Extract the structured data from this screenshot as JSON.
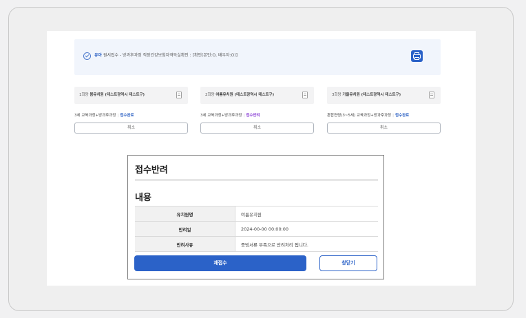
{
  "notice": {
    "highlight": "유아",
    "text": " 원서접수 - 방과후과정 직장건강보험자격득실확인 : [확인(본인:O, 배우자:O)]"
  },
  "choices": [
    {
      "rank": "1희망",
      "name": "봄유치원 (테스트광역시 테스트구)",
      "program": "3세 교육과정+방과후과정",
      "status": "접수완료",
      "cancel": "취소"
    },
    {
      "rank": "2희망",
      "name": "여름유치원 (테스트광역시 테스트구)",
      "program": "3세 교육과정+방과후과정",
      "status": "접수반려",
      "cancel": "취소"
    },
    {
      "rank": "3희망",
      "name": "가을유치원 (테스트광역시 테스트구)",
      "program": "혼합연령(3~5세) 교육과정+방과후과정",
      "status": "접수완료",
      "cancel": "취소"
    }
  ],
  "modal": {
    "title": "접수반려",
    "section": "내용",
    "rows": [
      {
        "label": "유치원명",
        "value": "여름유치원"
      },
      {
        "label": "반려일",
        "value": "2024-00-00 00:00:00"
      },
      {
        "label": "반려사유",
        "value": "증빙서류 부족으로 반려처리 됩니다."
      }
    ],
    "resubmit": "재접수",
    "close": "창닫기"
  },
  "colors": {
    "primary": "#2b62c8",
    "status_done": "#2d62c4",
    "status_rejected": "#8a3fd6"
  },
  "icons": [
    "check-circle-icon",
    "printer-icon",
    "document-icon"
  ]
}
